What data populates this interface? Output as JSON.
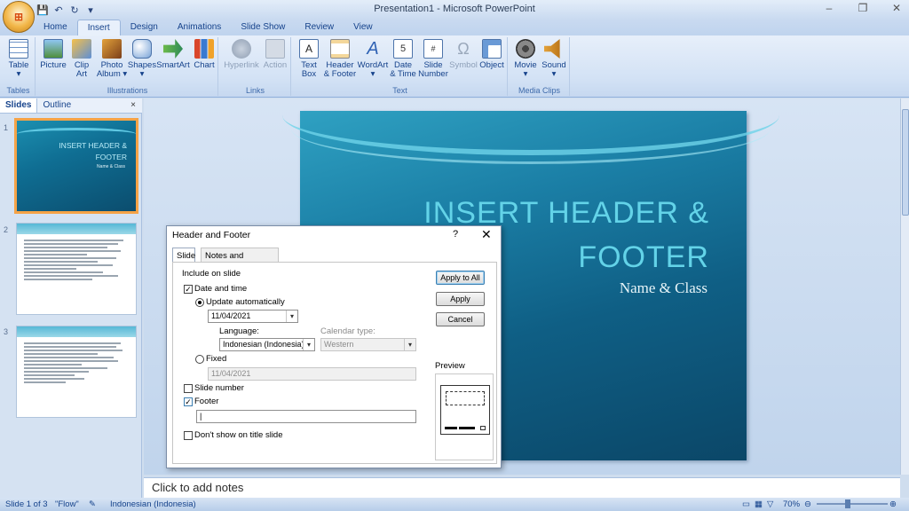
{
  "window": {
    "title": "Presentation1 - Microsoft PowerPoint",
    "controls": [
      "–",
      "❐",
      "✕"
    ]
  },
  "ribbon": {
    "tabs": [
      "Home",
      "Insert",
      "Design",
      "Animations",
      "Slide Show",
      "Review",
      "View"
    ],
    "active_tab": "Insert",
    "groups": [
      {
        "caption": "Tables",
        "buttons": [
          {
            "label": "Table",
            "sub": "▾"
          }
        ]
      },
      {
        "caption": "Illustrations",
        "buttons": [
          {
            "label": "Picture",
            "sub": ""
          },
          {
            "label": "Clip",
            "sub": "Art"
          },
          {
            "label": "Photo",
            "sub": "Album ▾"
          },
          {
            "label": "Shapes",
            "sub": "▾"
          },
          {
            "label": "SmartArt",
            "sub": ""
          },
          {
            "label": "Chart",
            "sub": ""
          }
        ]
      },
      {
        "caption": "Links",
        "buttons": [
          {
            "label": "Hyperlink",
            "sub": ""
          },
          {
            "label": "Action",
            "sub": ""
          }
        ]
      },
      {
        "caption": "Text",
        "buttons": [
          {
            "label": "Text",
            "sub": "Box"
          },
          {
            "label": "Header",
            "sub": "& Footer"
          },
          {
            "label": "WordArt",
            "sub": "▾"
          },
          {
            "label": "Date",
            "sub": "& Time"
          },
          {
            "label": "Slide",
            "sub": "Number"
          },
          {
            "label": "Symbol",
            "sub": ""
          },
          {
            "label": "Object",
            "sub": ""
          }
        ]
      },
      {
        "caption": "Media Clips",
        "buttons": [
          {
            "label": "Movie",
            "sub": "▾"
          },
          {
            "label": "Sound",
            "sub": "▾"
          }
        ]
      }
    ]
  },
  "panes": {
    "tabs": [
      "Slides",
      "Outline"
    ],
    "close": "×",
    "slide_numbers": [
      "1",
      "2",
      "3"
    ],
    "thumb1": {
      "title": "INSERT HEADER & FOOTER",
      "subtitle": "Name & Class"
    }
  },
  "slide": {
    "title_line1": "INSERT HEADER &",
    "title_line2": "FOOTER",
    "subtitle": "Name & Class"
  },
  "notes": {
    "placeholder": "Click to add notes"
  },
  "status": {
    "slide_info": "Slide 1 of 3",
    "theme": "\"Flow\"",
    "language": "Indonesian (Indonesia)",
    "zoom": "70%"
  },
  "dialog": {
    "title": "Header and Footer",
    "help": "?",
    "close": "✕",
    "tabs": [
      "Slide",
      "Notes and Handouts"
    ],
    "include_label": "Include on slide",
    "date_time": {
      "label": "Date and time",
      "checked": true
    },
    "update_auto": {
      "label": "Update automatically",
      "selected": true
    },
    "date_value": "11/04/2021",
    "language_label": "Language:",
    "language_value": "Indonesian (Indonesia)",
    "calendar_label": "Calendar type:",
    "calendar_value": "Western",
    "fixed": {
      "label": "Fixed",
      "selected": false
    },
    "fixed_value": "11/04/2021",
    "slide_number": {
      "label": "Slide number",
      "checked": false
    },
    "footer": {
      "label": "Footer",
      "checked": true,
      "value": ""
    },
    "dont_show": {
      "label": "Don't show on title slide",
      "checked": false
    },
    "buttons": {
      "apply_all": "Apply to All",
      "apply": "Apply",
      "cancel": "Cancel"
    },
    "preview_label": "Preview"
  }
}
